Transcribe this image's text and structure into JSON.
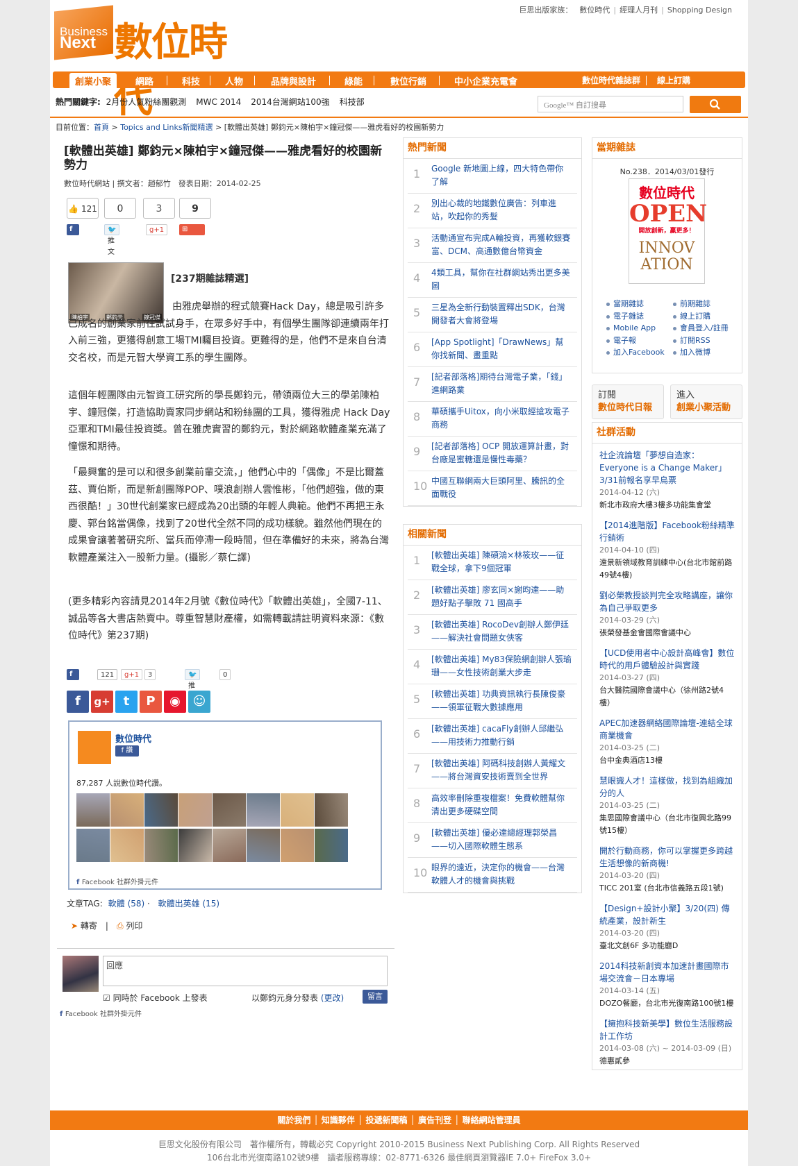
{
  "header": {
    "top_links": [
      "巨思出版家族：",
      "數位時代",
      "經理人月刊",
      "Shopping Design"
    ],
    "logo_en1": "Business",
    "logo_en2": "Next",
    "logo_zh": "數位時代"
  },
  "nav": {
    "items": [
      "創業小聚",
      "網路",
      "科技",
      "人物",
      "品牌與設計",
      "綠能",
      "數位行銷",
      "中小企業充電會"
    ],
    "right": [
      "數位時代雜誌群",
      "線上訂購"
    ]
  },
  "hot": {
    "label": "熱門關鍵字:",
    "keywords": [
      "2月份人氣粉絲團觀測",
      "MWC 2014",
      "2014台灣網站100強",
      "科技部"
    ]
  },
  "search": {
    "placeholder": "Google™ 自訂搜尋"
  },
  "breadcrumb": {
    "prefix": "目前位置：",
    "home": "首頁",
    "section": "Topics and Links新聞精選",
    "sep": ">",
    "current": "[軟體出英雄] 鄭鈞元×陳柏宇×鐘冠傑——雅虎看好的校園新勢力"
  },
  "article": {
    "title": "[軟體出英雄] 鄭鈞元×陳柏宇×鐘冠傑——雅虎看好的校園新勢力",
    "meta": "數位時代網站 | 撰文者：趙郁竹　發表日期：2014-02-25",
    "counts": {
      "fb": "121",
      "tweet": "0",
      "gplus": "3",
      "share": "9"
    },
    "btns": {
      "fb": "讚",
      "tweet": "推文",
      "gplus": "+1",
      "share": "Share"
    },
    "photo_names": [
      "陳柏宇",
      "鄭鈞元",
      "鐘冠傑"
    ],
    "p1": "[237期雜誌精選]",
    "p2": "由雅虎舉辦的程式競賽Hack Day，總是吸引許多已成名的創業家前往試試身手，在眾多好手中，有個學生團隊卻連續兩年打入前三強，更獲得創意工場TMI矚目投資。更難得的是，他們不是來自台清交名校，而是元智大學資工系的學生團隊。",
    "p3": "這個年輕團隊由元智資工研究所的學長鄭鈞元，帶領兩位大三的學弟陳柏宇、鐘冠傑，打造協助賣家同步網站和粉絲團的工具，獲得雅虎 Hack Day亞軍和TMI最佳投資獎。曾在雅虎實習的鄭鈞元，對於網路軟體產業充滿了憧憬和期待。",
    "p4": "「最興奮的是可以和很多創業前輩交流，」他們心中的「偶像」不是比爾蓋茲、賈伯斯，而是新創團隊POP、噗浪創辦人雲惟彬，「他們超強，做的東西很酷！」30世代創業家已經成為20出頭的年輕人典範。他們不再把王永慶、郭台銘當偶像，找到了20世代全然不同的成功樣貌。雖然他們現在的成果會讓著著研究所、當兵而停滯一段時間，但在準備好的未來，將為台灣軟體產業注入一股新力量。(攝影／蔡仁譯)",
    "p5": "(更多精彩內容請見2014年2月號《數位時代》「軟體出英雄」，全國7-11、誠品等各大書店熱賣中。尊重智慧財產權，如需轉載請註明資料來源：《數位時代》第237期)",
    "share2": {
      "fb": "讚",
      "fbc": "121",
      "g": "+1",
      "gc": "3",
      "tw": "推文",
      "twc": "0"
    },
    "fbbox": {
      "name": "數位時代",
      "like": "讚",
      "count": "87,287 人說數位時代讚。",
      "foot": "Facebook 社群外掛元件"
    },
    "tags": {
      "label": "文章TAG:",
      "items": [
        "軟體 (58)",
        "軟體出英雄 (15)"
      ]
    },
    "tools": {
      "forward": "轉寄",
      "print": "列印"
    },
    "comment": {
      "placeholder": "回應",
      "also": "同時於 Facebook 上發表",
      "as": "以鄭鈞元身分發表",
      "change": "(更改)",
      "btn": "留言",
      "foot": "Facebook 社群外掛元件"
    }
  },
  "hot_news": {
    "title": "熱門新聞",
    "items": [
      "Google 新地圖上線，四大特色帶你了解",
      "別出心裁的地鐵數位廣告：列車進站，吹起你的秀髮",
      "活動通宣布完成A輪投資，再獲軟銀賽富、DCM、高通數億台幣資金",
      "4類工具，幫你在社群網站秀出更多美圖",
      "三星為全新行動裝置釋出SDK，台灣開發者大會將登場",
      "[App Spotlight]「DrawNews」幫你找新聞、畫重點",
      "[記者部落格]期待台灣電子業，「錢」進網路業",
      "華碩攜手Uitox，向小米取經搶攻電子商務",
      "[記者部落格] OCP 開放運算計畫，對台廠是蜜糖還是慢性毒藥？",
      "中國互聯網兩大巨頭阿里、騰訊的全面戰役"
    ]
  },
  "related": {
    "title": "相關新聞",
    "items": [
      "[軟體出英雄] 陳碩鴻×林筱玫——征戰全球，拿下9個冠軍",
      "[軟體出英雄] 廖玄同×謝昀達——助題好點子擊敗 71 國高手",
      "[軟體出英雄] RocoDev創辦人鄭伊廷——解決社會問題女俠客",
      "[軟體出英雄] My83保險網創辦人張瑜珊——女性技術創業大步走",
      "[軟體出英雄] 功典資訊執行長陳俊豪——領軍征戰大數據應用",
      "[軟體出英雄] cacaFly創辦人邱繼弘——用技術力推動行銷",
      "[軟體出英雄] 阿碼科技創辦人黃耀文——將台灣資安技術賣到全世界",
      "高效率刪除重複檔案！免費軟體幫你清出更多硬碟空間",
      "[軟體出英雄] 優必達總經理郭榮昌——切入國際軟體生態系",
      "眼界的遠近，決定你的機會——台灣軟體人才的機會與挑戰"
    ]
  },
  "magazine": {
    "title": "當期雜誌",
    "issue": "No.238．2014/03/01發行",
    "cover_title": "數位時代",
    "cover_open": "OPEN",
    "cover_sub": "開放創新，贏更多！",
    "cover_inno1": "INNOV",
    "cover_inno2": "ATION",
    "left_links": [
      "當期雜誌",
      "電子雜誌",
      "Mobile App",
      "電子報",
      "加入Facebook"
    ],
    "right_links": [
      "前期雜誌",
      "線上訂購",
      "會員登入/註冊",
      "訂閱RSS",
      "加入微博"
    ]
  },
  "subscribe": [
    {
      "l1": "訂閱",
      "l2": "數位時代日報"
    },
    {
      "l1": "進入",
      "l2": "創業小聚活動"
    }
  ],
  "events": {
    "title": "社群活動",
    "items": [
      {
        "t": "社企流論壇「夢想自造家：Everyone is a Change Maker」3/31前報名享早鳥票",
        "d": "2014-04-12 (六)",
        "p": "新北市政府大樓3樓多功能集會堂"
      },
      {
        "t": "【2014進階版】Facebook粉絲精準行銷術",
        "d": "2014-04-10 (四)",
        "p": "遠景新領域教育訓練中心(台北市館前路49號4樓)"
      },
      {
        "t": "劉必榮教授談判完全攻略講座，讓你為自己爭取更多",
        "d": "2014-03-29 (六)",
        "p": "張榮發基金會國際會議中心"
      },
      {
        "t": "【UCD使用者中心設計高峰會】數位時代的用戶體驗設計與實踐",
        "d": "2014-03-27 (四)",
        "p": "台大醫院國際會議中心（徐州路2號4樓）"
      },
      {
        "t": "APEC加速器網絡國際論壇-連結全球商業機會",
        "d": "2014-03-25 (二)",
        "p": "台中金典酒店13樓"
      },
      {
        "t": "慧眼識人才！這樣做，找到為組織加分的人",
        "d": "2014-03-25 (二)",
        "p": "集思國際會議中心（台北市復興北路99號15樓）"
      },
      {
        "t": "開於行動商務，你可以掌握更多跨越生活想像的新商機!",
        "d": "2014-03-20 (四)",
        "p": "TICC 201室 (台北市信義路五段1號)"
      },
      {
        "t": "【Design+設計小聚】3/20(四) 傳統產業，設計新生",
        "d": "2014-03-20 (四)",
        "p": "臺北文創6F 多功能廳D"
      },
      {
        "t": "2014科技新創資本加速計畫國際市場交流會－日本專場",
        "d": "2014-03-14 (五)",
        "p": "DOZO餐廳，台北市光復南路100號1樓"
      },
      {
        "t": "【擁抱科技新美學】數位生活服務設計工作坊",
        "d": "2014-03-08 (六) ~ 2014-03-09 (日)",
        "p": "德惠貳參"
      }
    ]
  },
  "footer": {
    "links": "關於我們 │ 知識夥伴 │ 投遞新聞稿 │ 廣告刊登 │ 聯絡網站管理員",
    "copy1": "巨思文化股份有限公司　著作權所有，轉載必究 Copyright 2010-2015 Business Next Publishing Corp. All Rights Reserved",
    "copy2": "106台北市光復南路102號9樓　讀者服務專線：02-8771-6326 最佳網頁瀏覽器IE 7.0+ FireFox 3.0+"
  },
  "colors": {
    "brand": "#f27a12",
    "link": "#1a4f9c"
  }
}
